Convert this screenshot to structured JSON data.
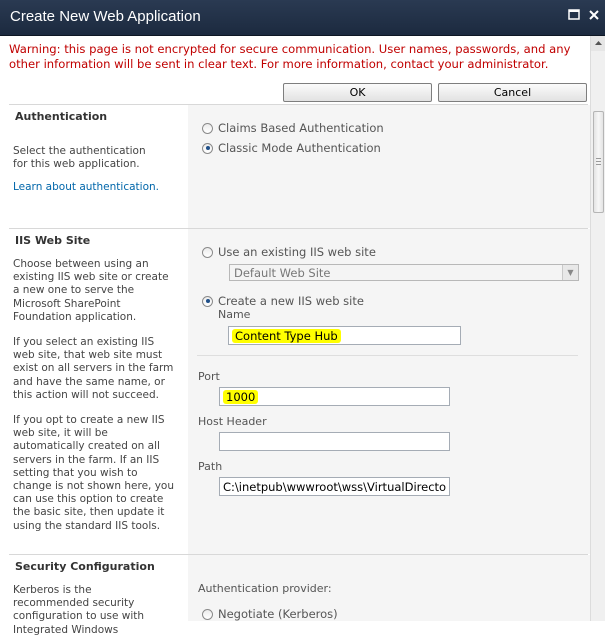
{
  "dialog": {
    "title": "Create New Web Application",
    "maximize_icon": "maximize-icon",
    "close_icon": "close-icon"
  },
  "warning": "Warning: this page is not encrypted for secure communication. User names, passwords, and any other information will be sent in clear text. For more information, contact your administrator.",
  "buttons": {
    "ok": "OK",
    "cancel": "Cancel"
  },
  "authentication": {
    "title": "Authentication",
    "description": "Select the authentication for this web application.",
    "link": "Learn about authentication.",
    "options": [
      {
        "label": "Claims Based Authentication",
        "checked": false
      },
      {
        "label": "Classic Mode Authentication",
        "checked": true
      }
    ]
  },
  "iis": {
    "title": "IIS Web Site",
    "desc1": "Choose between using an existing IIS web site or create a new one to serve the Microsoft SharePoint Foundation application.",
    "desc2": "If you select an existing IIS web site, that web site must exist on all servers in the farm and have the same name, or this action will not succeed.",
    "desc3": "If you opt to create a new IIS web site, it will be automatically created on all servers in the farm.  If an IIS setting that you wish to change is not shown here, you can use this option to create the basic site, then update it using the standard IIS tools.",
    "use_existing_label": "Use an existing IIS web site",
    "existing_select": "Default Web Site",
    "create_new_label": "Create a new IIS web site",
    "name_label": "Name",
    "name_value": "Content Type Hub",
    "port_label": "Port",
    "port_value": "1000",
    "host_header_label": "Host Header",
    "host_header_value": "",
    "path_label": "Path",
    "path_value": "C:\\inetpub\\wwwroot\\wss\\VirtualDirecto"
  },
  "security": {
    "title": "Security Configuration",
    "description": "Kerberos is the recommended security configuration to use with Integrated Windows",
    "provider_label": "Authentication provider:",
    "negotiate_label": "Negotiate (Kerberos)"
  }
}
